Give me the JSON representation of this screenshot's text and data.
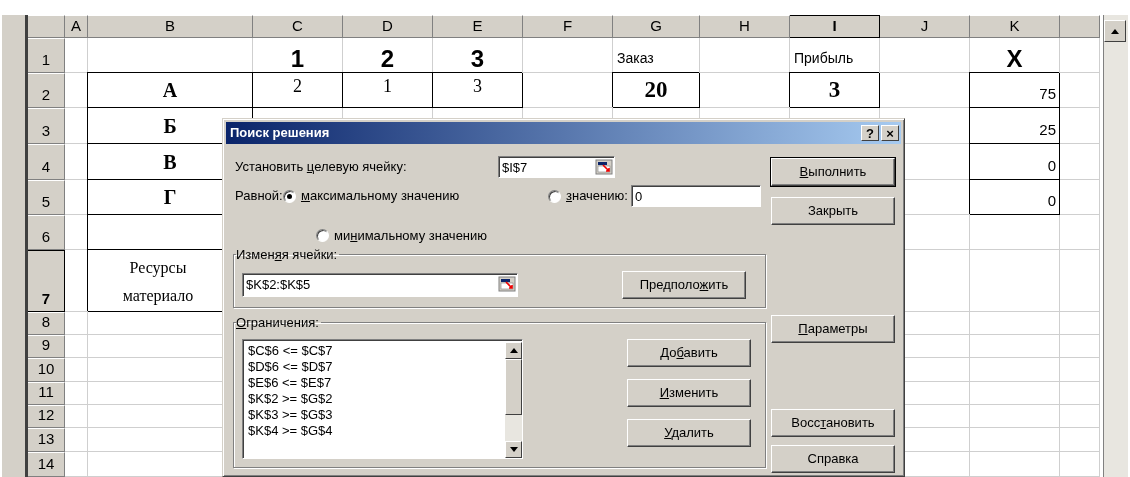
{
  "sheet": {
    "column_headers": [
      {
        "label": "A",
        "selected": false
      },
      {
        "label": "B",
        "selected": false
      },
      {
        "label": "C",
        "selected": false
      },
      {
        "label": "D",
        "selected": false
      },
      {
        "label": "E",
        "selected": false
      },
      {
        "label": "F",
        "selected": false
      },
      {
        "label": "G",
        "selected": false
      },
      {
        "label": "H",
        "selected": false
      },
      {
        "label": "I",
        "selected": true
      },
      {
        "label": "J",
        "selected": false
      },
      {
        "label": "K",
        "selected": false
      }
    ],
    "rows": [
      {
        "header": "1",
        "selected": false,
        "cells": [
          null,
          null,
          {
            "text": "1",
            "kind": "title"
          },
          {
            "text": "2",
            "kind": "title"
          },
          {
            "text": "3",
            "kind": "title"
          },
          null,
          {
            "text": "Заказ",
            "kind": "label"
          },
          null,
          {
            "text": "Прибыль",
            "kind": "label"
          },
          null,
          {
            "text": "X",
            "kind": "title"
          }
        ]
      },
      {
        "header": "2",
        "selected": false,
        "cells": [
          null,
          {
            "text": "А",
            "kind": "name",
            "boxed": true
          },
          {
            "text": "2",
            "kind": "value",
            "boxed": true
          },
          {
            "text": "1",
            "kind": "value",
            "boxed": true
          },
          {
            "text": "3",
            "kind": "value",
            "boxed": true
          },
          null,
          {
            "text": "20",
            "kind": "total",
            "boxed": true
          },
          null,
          {
            "text": "3",
            "kind": "total",
            "boxed": true
          },
          null,
          {
            "text": "75",
            "kind": "number",
            "boxed": true
          }
        ]
      },
      {
        "header": "3",
        "selected": false,
        "cells": [
          null,
          {
            "text": "Б",
            "kind": "name",
            "boxed": true
          },
          null,
          null,
          null,
          null,
          null,
          null,
          null,
          null,
          {
            "text": "25",
            "kind": "number",
            "boxed": true
          }
        ]
      },
      {
        "header": "4",
        "selected": false,
        "cells": [
          null,
          {
            "text": "В",
            "kind": "name",
            "boxed": true
          },
          null,
          null,
          null,
          null,
          null,
          null,
          null,
          null,
          {
            "text": "0",
            "kind": "number",
            "boxed": true
          }
        ]
      },
      {
        "header": "5",
        "selected": false,
        "cells": [
          null,
          {
            "text": "Г",
            "kind": "name",
            "boxed": true
          },
          null,
          null,
          null,
          null,
          null,
          null,
          null,
          null,
          {
            "text": "0",
            "kind": "number",
            "boxed": true
          }
        ]
      },
      {
        "header": "6",
        "selected": false,
        "cells": [
          null,
          {
            "boxed": true
          }
        ]
      },
      {
        "header": "7",
        "selected": true,
        "cells": [
          null,
          {
            "text": "Ресурсы материало",
            "kind": "note",
            "boxed": true
          }
        ]
      },
      {
        "header": "8",
        "selected": false
      },
      {
        "header": "9",
        "selected": false
      },
      {
        "header": "10",
        "selected": false
      },
      {
        "header": "11",
        "selected": false
      },
      {
        "header": "12",
        "selected": false
      },
      {
        "header": "13",
        "selected": false
      },
      {
        "header": "14",
        "selected": false
      }
    ]
  },
  "dialog": {
    "title": "Поиск решения",
    "help_button": "?",
    "close_button": "×",
    "target": {
      "label": {
        "pre": "Установить ",
        "key": "ц",
        "post": "елевую ячейку:"
      },
      "value": "$I$7"
    },
    "equal_label": "Равной:",
    "options": [
      {
        "label": {
          "key": "м",
          "post": "аксимальному значению"
        },
        "selected": true
      },
      {
        "label": {
          "key": "з",
          "post": "начению:"
        },
        "selected": false
      },
      {
        "label": {
          "pre": "ми",
          "key": "н",
          "post": "имальному значению"
        },
        "selected": false
      }
    ],
    "value_field": "0",
    "changing": {
      "label": {
        "pre": "Измен",
        "key": "я",
        "post": "я ячейки:"
      },
      "value": "$K$2:$K$5",
      "guess_button": {
        "pre": "Предполо",
        "key": "ж",
        "post": "ить"
      }
    },
    "constraints": {
      "label": {
        "key": "О",
        "post": "граничения:"
      },
      "items": [
        {
          "text": "$C$6 <= $C$7",
          "selected": false
        },
        {
          "text": "$D$6 <= $D$7",
          "selected": false
        },
        {
          "text": "$E$6 <= $E$7",
          "selected": false
        },
        {
          "text": "$K$2 >= $G$2",
          "selected": false
        },
        {
          "text": "$K$3 >= $G$3",
          "selected": false
        },
        {
          "text": "$K$4 >= $G$4",
          "selected": false
        }
      ],
      "buttons": [
        {
          "pre": "До",
          "key": "б",
          "post": "авить"
        },
        {
          "key": "И",
          "post": "зменить"
        },
        {
          "key": "У",
          "post": "далить"
        }
      ]
    },
    "side_buttons": [
      {
        "label": {
          "key": "В",
          "post": "ыполнить"
        },
        "default": true
      },
      {
        "label": {
          "post": "Закрыть"
        },
        "default": false
      },
      {
        "label": {
          "key": "П",
          "post": "араметры"
        },
        "default": false
      },
      {
        "label": {
          "pre": "Восс",
          "key": "т",
          "post": "ановить"
        },
        "default": false
      },
      {
        "label": {
          "post": "Справка"
        },
        "default": false
      }
    ]
  }
}
